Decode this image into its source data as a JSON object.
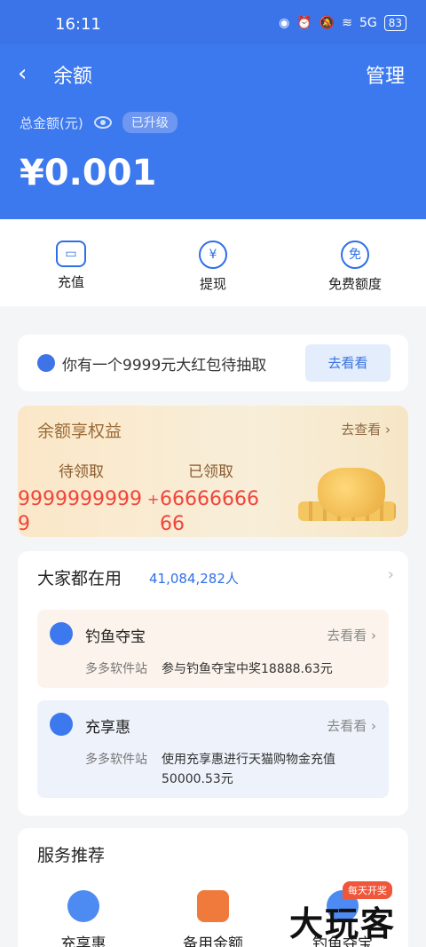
{
  "status": {
    "time": "16:11",
    "battery": "83",
    "signal": "5G"
  },
  "nav": {
    "back_icon": "chevron-left-icon",
    "title": "余额",
    "manage": "管理"
  },
  "balance": {
    "label": "总金额(元)",
    "badge": "已升级",
    "amount": "¥0.001"
  },
  "actions": [
    {
      "label": "充值",
      "icon": "wallet-icon"
    },
    {
      "label": "提现",
      "icon": "yuan-transfer-icon"
    },
    {
      "label": "免费额度",
      "icon": "free-icon"
    }
  ],
  "redpack": {
    "text": "你有一个9999元大红包待抽取",
    "button": "去看看"
  },
  "rights": {
    "title": "余额享权益",
    "more": "去查看",
    "pending_label": "待领取",
    "received_label": "已领取",
    "pending_value": "99999999999",
    "plus": "+",
    "received_value": "6666666666"
  },
  "using": {
    "title": "大家都在用",
    "count": "41,084,282人",
    "items": [
      {
        "name": "钓鱼夺宝",
        "go": "去看看",
        "source": "多多软件站",
        "desc": "参与钓鱼夺宝中奖18888.63元"
      },
      {
        "name": "充享惠",
        "go": "去看看",
        "source": "多多软件站",
        "desc": "使用充享惠进行天猫购物金充值50000.53元"
      }
    ]
  },
  "service": {
    "title": "服务推荐",
    "tag": "每天开奖",
    "items": [
      {
        "label": "充享惠"
      },
      {
        "label": "备用金额"
      },
      {
        "label": "钓鱼夺宝"
      }
    ]
  },
  "watermark": "大玩客"
}
